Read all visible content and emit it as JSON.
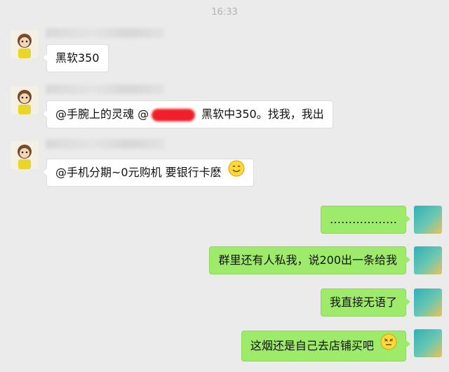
{
  "timestamp": "16:33",
  "messages": [
    {
      "text": "黑软350"
    },
    {
      "text_a": "@手腕上的灵魂 @",
      "text_b": " 黑软中350。找我，我出"
    },
    {
      "text": "@手机分期~0元购机 要银行卡麽",
      "emoji": "smile-emoji"
    },
    {
      "text": "………………"
    },
    {
      "text": "群里还有人私我，说200出一条给我"
    },
    {
      "text": "我直接无语了"
    },
    {
      "text": "这烟还是自己去店铺买吧",
      "emoji": "dismissive-emoji"
    }
  ],
  "colors": {
    "outgoing_bubble": "#9eea6a",
    "incoming_bubble": "#ffffff",
    "background": "#ebebeb",
    "redaction": "#f0202a"
  }
}
